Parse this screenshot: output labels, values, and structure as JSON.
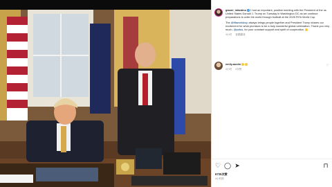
{
  "window": {
    "close_icon": "close-icon"
  },
  "post": {
    "username": "gianni_infantino",
    "caption_p1": "I had an important, positive meeting with the President of the us United States Donald J. Trump on Tuesday in Washington DC as we continue preparations to unite the world through football at the 2026 FIFA World Cup.",
    "caption_p2_pre": "The ",
    "caption_mention1": "@fifaworldcup",
    "caption_p2_mid": " always brings people together and President Trump shares our excitement for what promises to be a truly wonderful global celebration. Thank you very much, ",
    "caption_mention2": "@potus",
    "caption_p2_post": ", for your constant support and spirit of cooperation.",
    "time_ago": "4小时",
    "translate_label": "查看翻译"
  },
  "comment": {
    "username": "emily.austin",
    "time_ago": "4小时",
    "likes_label": "2次赞"
  },
  "stats": {
    "likes": "6735次赞",
    "date": "4小时前"
  },
  "colors": {
    "accent": "#3897f0",
    "mention": "#00376b",
    "panel_bg": "#ffffff"
  }
}
